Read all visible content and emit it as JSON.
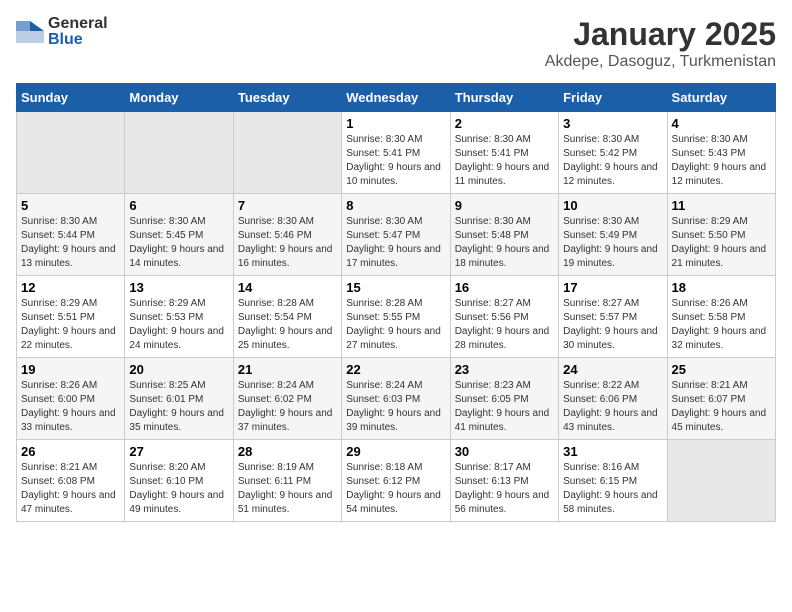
{
  "header": {
    "logo_general": "General",
    "logo_blue": "Blue",
    "title": "January 2025",
    "subtitle": "Akdepe, Dasoguz, Turkmenistan"
  },
  "days_of_week": [
    "Sunday",
    "Monday",
    "Tuesday",
    "Wednesday",
    "Thursday",
    "Friday",
    "Saturday"
  ],
  "weeks": [
    [
      {
        "day": "",
        "info": ""
      },
      {
        "day": "",
        "info": ""
      },
      {
        "day": "",
        "info": ""
      },
      {
        "day": "1",
        "info": "Sunrise: 8:30 AM\nSunset: 5:41 PM\nDaylight: 9 hours and 10 minutes."
      },
      {
        "day": "2",
        "info": "Sunrise: 8:30 AM\nSunset: 5:41 PM\nDaylight: 9 hours and 11 minutes."
      },
      {
        "day": "3",
        "info": "Sunrise: 8:30 AM\nSunset: 5:42 PM\nDaylight: 9 hours and 12 minutes."
      },
      {
        "day": "4",
        "info": "Sunrise: 8:30 AM\nSunset: 5:43 PM\nDaylight: 9 hours and 12 minutes."
      }
    ],
    [
      {
        "day": "5",
        "info": "Sunrise: 8:30 AM\nSunset: 5:44 PM\nDaylight: 9 hours and 13 minutes."
      },
      {
        "day": "6",
        "info": "Sunrise: 8:30 AM\nSunset: 5:45 PM\nDaylight: 9 hours and 14 minutes."
      },
      {
        "day": "7",
        "info": "Sunrise: 8:30 AM\nSunset: 5:46 PM\nDaylight: 9 hours and 16 minutes."
      },
      {
        "day": "8",
        "info": "Sunrise: 8:30 AM\nSunset: 5:47 PM\nDaylight: 9 hours and 17 minutes."
      },
      {
        "day": "9",
        "info": "Sunrise: 8:30 AM\nSunset: 5:48 PM\nDaylight: 9 hours and 18 minutes."
      },
      {
        "day": "10",
        "info": "Sunrise: 8:30 AM\nSunset: 5:49 PM\nDaylight: 9 hours and 19 minutes."
      },
      {
        "day": "11",
        "info": "Sunrise: 8:29 AM\nSunset: 5:50 PM\nDaylight: 9 hours and 21 minutes."
      }
    ],
    [
      {
        "day": "12",
        "info": "Sunrise: 8:29 AM\nSunset: 5:51 PM\nDaylight: 9 hours and 22 minutes."
      },
      {
        "day": "13",
        "info": "Sunrise: 8:29 AM\nSunset: 5:53 PM\nDaylight: 9 hours and 24 minutes."
      },
      {
        "day": "14",
        "info": "Sunrise: 8:28 AM\nSunset: 5:54 PM\nDaylight: 9 hours and 25 minutes."
      },
      {
        "day": "15",
        "info": "Sunrise: 8:28 AM\nSunset: 5:55 PM\nDaylight: 9 hours and 27 minutes."
      },
      {
        "day": "16",
        "info": "Sunrise: 8:27 AM\nSunset: 5:56 PM\nDaylight: 9 hours and 28 minutes."
      },
      {
        "day": "17",
        "info": "Sunrise: 8:27 AM\nSunset: 5:57 PM\nDaylight: 9 hours and 30 minutes."
      },
      {
        "day": "18",
        "info": "Sunrise: 8:26 AM\nSunset: 5:58 PM\nDaylight: 9 hours and 32 minutes."
      }
    ],
    [
      {
        "day": "19",
        "info": "Sunrise: 8:26 AM\nSunset: 6:00 PM\nDaylight: 9 hours and 33 minutes."
      },
      {
        "day": "20",
        "info": "Sunrise: 8:25 AM\nSunset: 6:01 PM\nDaylight: 9 hours and 35 minutes."
      },
      {
        "day": "21",
        "info": "Sunrise: 8:24 AM\nSunset: 6:02 PM\nDaylight: 9 hours and 37 minutes."
      },
      {
        "day": "22",
        "info": "Sunrise: 8:24 AM\nSunset: 6:03 PM\nDaylight: 9 hours and 39 minutes."
      },
      {
        "day": "23",
        "info": "Sunrise: 8:23 AM\nSunset: 6:05 PM\nDaylight: 9 hours and 41 minutes."
      },
      {
        "day": "24",
        "info": "Sunrise: 8:22 AM\nSunset: 6:06 PM\nDaylight: 9 hours and 43 minutes."
      },
      {
        "day": "25",
        "info": "Sunrise: 8:21 AM\nSunset: 6:07 PM\nDaylight: 9 hours and 45 minutes."
      }
    ],
    [
      {
        "day": "26",
        "info": "Sunrise: 8:21 AM\nSunset: 6:08 PM\nDaylight: 9 hours and 47 minutes."
      },
      {
        "day": "27",
        "info": "Sunrise: 8:20 AM\nSunset: 6:10 PM\nDaylight: 9 hours and 49 minutes."
      },
      {
        "day": "28",
        "info": "Sunrise: 8:19 AM\nSunset: 6:11 PM\nDaylight: 9 hours and 51 minutes."
      },
      {
        "day": "29",
        "info": "Sunrise: 8:18 AM\nSunset: 6:12 PM\nDaylight: 9 hours and 54 minutes."
      },
      {
        "day": "30",
        "info": "Sunrise: 8:17 AM\nSunset: 6:13 PM\nDaylight: 9 hours and 56 minutes."
      },
      {
        "day": "31",
        "info": "Sunrise: 8:16 AM\nSunset: 6:15 PM\nDaylight: 9 hours and 58 minutes."
      },
      {
        "day": "",
        "info": ""
      }
    ]
  ]
}
